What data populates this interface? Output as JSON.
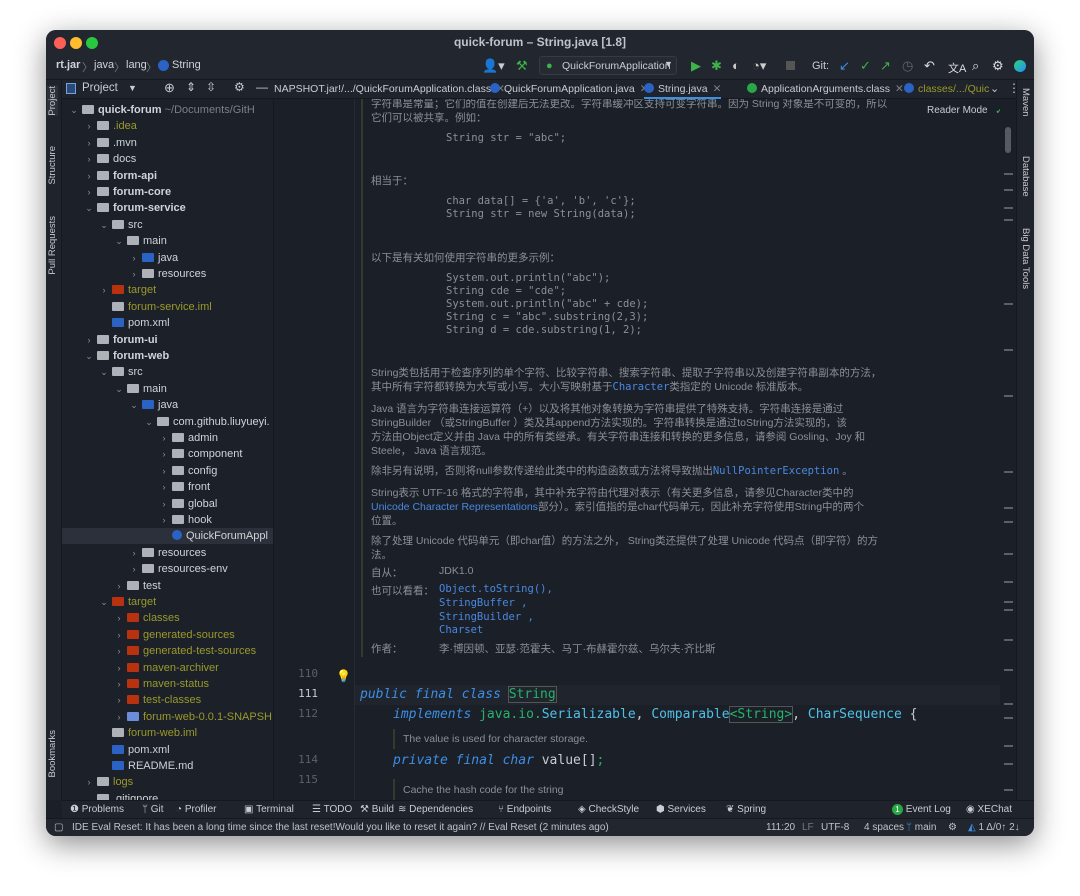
{
  "window": {
    "title": "quick-forum – String.java [1.8]"
  },
  "breadcrumb": [
    "rt.jar",
    "java",
    "lang",
    "String"
  ],
  "toolbar": {
    "run_config": "QuickForumApplication",
    "git_label": "Git:"
  },
  "project_panel": {
    "title": "Project"
  },
  "tabs": [
    {
      "label": "NAPSHOT.jar!/.../QuickForumApplication.class",
      "active": false
    },
    {
      "label": "QuickForumApplication.java",
      "active": false
    },
    {
      "label": "String.java",
      "active": true
    },
    {
      "label": "ApplicationArguments.class",
      "active": false
    },
    {
      "label": "classes/.../Quic",
      "active": false
    }
  ],
  "left_stripe": [
    "Project",
    "Structure",
    "Pull Requests",
    "Bookmarks"
  ],
  "right_stripe": [
    "Maven",
    "Database",
    "Big Data Tools"
  ],
  "tree": [
    {
      "label": "quick-forum",
      "extra": " ~/Documents/GitH",
      "d": 0,
      "exp": "v",
      "icon": "module",
      "color": "#d0d3d8",
      "bold": true
    },
    {
      "label": ".idea",
      "d": 1,
      "exp": ">",
      "icon": "folder",
      "color": "#9a9a2a"
    },
    {
      "label": ".mvn",
      "d": 1,
      "exp": ">",
      "icon": "folder",
      "color": "#d0d3d8"
    },
    {
      "label": "docs",
      "d": 1,
      "exp": ">",
      "icon": "folder",
      "color": "#d0d3d8"
    },
    {
      "label": "form-api",
      "d": 1,
      "exp": ">",
      "icon": "module",
      "color": "#d0d3d8",
      "bold": true
    },
    {
      "label": "forum-core",
      "d": 1,
      "exp": ">",
      "icon": "module",
      "color": "#d0d3d8",
      "bold": true
    },
    {
      "label": "forum-service",
      "d": 1,
      "exp": "v",
      "icon": "module",
      "color": "#d0d3d8",
      "bold": true
    },
    {
      "label": "src",
      "d": 2,
      "exp": "v",
      "icon": "folder",
      "color": "#d0d3d8"
    },
    {
      "label": "main",
      "d": 3,
      "exp": "v",
      "icon": "folder",
      "color": "#d0d3d8"
    },
    {
      "label": "java",
      "d": 4,
      "exp": ">",
      "icon": "src",
      "color": "#d0d3d8"
    },
    {
      "label": "resources",
      "d": 4,
      "exp": ">",
      "icon": "folder",
      "color": "#d0d3d8"
    },
    {
      "label": "target",
      "d": 2,
      "exp": ">",
      "icon": "excluded",
      "color": "#9a9a2a"
    },
    {
      "label": "forum-service.iml",
      "d": 2,
      "exp": "",
      "icon": "file",
      "color": "#9a9a2a"
    },
    {
      "label": "pom.xml",
      "d": 2,
      "exp": "",
      "icon": "maven",
      "color": "#d0d3d8"
    },
    {
      "label": "forum-ui",
      "d": 1,
      "exp": ">",
      "icon": "module",
      "color": "#d0d3d8",
      "bold": true
    },
    {
      "label": "forum-web",
      "d": 1,
      "exp": "v",
      "icon": "module",
      "color": "#d0d3d8",
      "bold": true
    },
    {
      "label": "src",
      "d": 2,
      "exp": "v",
      "icon": "folder",
      "color": "#d0d3d8"
    },
    {
      "label": "main",
      "d": 3,
      "exp": "v",
      "icon": "folder",
      "color": "#d0d3d8"
    },
    {
      "label": "java",
      "d": 4,
      "exp": "v",
      "icon": "src",
      "color": "#d0d3d8"
    },
    {
      "label": "com.github.liuyueyi.",
      "d": 5,
      "exp": "v",
      "icon": "package",
      "color": "#d0d3d8"
    },
    {
      "label": "admin",
      "d": 6,
      "exp": ">",
      "icon": "package",
      "color": "#d0d3d8"
    },
    {
      "label": "component",
      "d": 6,
      "exp": ">",
      "icon": "package",
      "color": "#d0d3d8"
    },
    {
      "label": "config",
      "d": 6,
      "exp": ">",
      "icon": "package",
      "color": "#d0d3d8"
    },
    {
      "label": "front",
      "d": 6,
      "exp": ">",
      "icon": "package",
      "color": "#d0d3d8"
    },
    {
      "label": "global",
      "d": 6,
      "exp": ">",
      "icon": "package",
      "color": "#d0d3d8"
    },
    {
      "label": "hook",
      "d": 6,
      "exp": ">",
      "icon": "package",
      "color": "#d0d3d8"
    },
    {
      "label": "QuickForumAppl",
      "d": 6,
      "exp": "",
      "icon": "class",
      "color": "#d0d3d8",
      "sel": true
    },
    {
      "label": "resources",
      "d": 4,
      "exp": ">",
      "icon": "folder",
      "color": "#d0d3d8"
    },
    {
      "label": "resources-env",
      "d": 4,
      "exp": ">",
      "icon": "folder",
      "color": "#d0d3d8"
    },
    {
      "label": "test",
      "d": 3,
      "exp": ">",
      "icon": "folder",
      "color": "#d0d3d8"
    },
    {
      "label": "target",
      "d": 2,
      "exp": "v",
      "icon": "excluded",
      "color": "#9a9a2a"
    },
    {
      "label": "classes",
      "d": 3,
      "exp": ">",
      "icon": "excluded",
      "color": "#9a9a2a"
    },
    {
      "label": "generated-sources",
      "d": 3,
      "exp": ">",
      "icon": "excluded",
      "color": "#9a9a2a"
    },
    {
      "label": "generated-test-sources",
      "d": 3,
      "exp": ">",
      "icon": "excluded",
      "color": "#9a9a2a"
    },
    {
      "label": "maven-archiver",
      "d": 3,
      "exp": ">",
      "icon": "excluded",
      "color": "#9a9a2a"
    },
    {
      "label": "maven-status",
      "d": 3,
      "exp": ">",
      "icon": "excluded",
      "color": "#9a9a2a"
    },
    {
      "label": "test-classes",
      "d": 3,
      "exp": ">",
      "icon": "excluded",
      "color": "#9a9a2a"
    },
    {
      "label": "forum-web-0.0.1-SNAPSH",
      "d": 3,
      "exp": ">",
      "icon": "jar",
      "color": "#9a9a2a"
    },
    {
      "label": "forum-web.iml",
      "d": 2,
      "exp": "",
      "icon": "file",
      "color": "#9a9a2a"
    },
    {
      "label": "pom.xml",
      "d": 2,
      "exp": "",
      "icon": "maven",
      "color": "#d0d3d8"
    },
    {
      "label": "README.md",
      "d": 2,
      "exp": "",
      "icon": "md",
      "color": "#d0d3d8"
    },
    {
      "label": "logs",
      "d": 1,
      "exp": ">",
      "icon": "folder",
      "color": "#9a9a2a"
    },
    {
      "label": ".gitignore",
      "d": 1,
      "exp": "",
      "icon": "file",
      "color": "#d0d3d8"
    }
  ],
  "editor": {
    "reader_mode": "Reader Mode",
    "doc": {
      "l0": "字符串是常量；它们的值在创建后无法更改。字符串缓冲区支持可变字符串。因为 String 对象是不可变的，所以",
      "l1": "它们可以被共享。例如：",
      "c1": "String str = \"abc\";",
      "l2": "相当于：",
      "c2a": "char data[] = {'a', 'b', 'c'};",
      "c2b": "String str = new String(data);",
      "l3": "以下是有关如何使用字符串的更多示例：",
      "c3": [
        "System.out.println(\"abc\");",
        "String cde = \"cde\";",
        "System.out.println(\"abc\" + cde);",
        "String c = \"abc\".substring(2,3);",
        "String d = cde.substring(1, 2);"
      ],
      "p1a": "String类包括用于检查序列的单个字符、比较字符串、搜索字符串、提取子字符串以及创建字符串副本的方法，",
      "p1b_pre": "其中所有字符都转换为大写或小写。大小写映射基于",
      "p1b_link": "Character",
      "p1b_post": "类指定的 Unicode 标准版本。",
      "p2": [
        "Java 语言为字符串连接运算符（+）以及将其他对象转换为字符串提供了特殊支持。字符串连接是通过",
        "StringBuilder （或StringBuffer ）类及其append方法实现的。字符串转换是通过toString方法实现的，该",
        "方法由Object定义并由 Java 中的所有类继承。有关字符串连接和转换的更多信息，请参阅 Gosling、Joy 和",
        "Steele， Java 语言规范。"
      ],
      "p3_pre": "除非另有说明，否则将null参数传递给此类中的构造函数或方法将导致抛出",
      "p3_link": "NullPointerException",
      "p3_post": " 。",
      "p4a": "String表示 UTF-16 格式的字符串，其中补充字符由代理对表示（有关更多信息，请参见Character类中的",
      "p4b_link": "Unicode Character Representations",
      "p4b_post": "部分）。索引值指的是char代码单元，因此补充字符使用String中的两个",
      "p4c": "位置。",
      "p5a": "除了处理 Unicode 代码单元（即char值）的方法之外， String类还提供了处理 Unicode 代码点（即字符）的方",
      "p5b": "法。",
      "since_label": "自从：",
      "since_value": "JDK1.0",
      "see_label": "也可以看看：",
      "see": [
        "Object.toString()",
        "StringBuffer",
        "StringBuilder",
        "Charset"
      ],
      "author_label": "作者：",
      "author_value": "李·博因顿、亚瑟·范霍夫、马丁·布赫霍尔兹、乌尔夫·齐比斯"
    },
    "lines": [
      "110",
      "111",
      "112",
      "114",
      "115"
    ],
    "code": {
      "kw_public": "public",
      "kw_final": "final",
      "kw_class": "class",
      "name": "String",
      "kw_implements": "implements",
      "pkg": "java.io.",
      "serializable": "Serializable",
      "comparable": "Comparable",
      "generic": "String",
      "charseq": "CharSequence",
      "comment1": "The value is used for character storage.",
      "kw_private": "private",
      "kw_char": "char",
      "field": "value[]",
      "comment2": "Cache the hash code for the string"
    }
  },
  "tool_windows": [
    "Problems",
    "Git",
    "Profiler",
    "Terminal",
    "TODO",
    "Build",
    "Dependencies",
    "Endpoints",
    "CheckStyle",
    "Services",
    "Spring"
  ],
  "tool_windows_right": {
    "event_log": "Event Log",
    "event_count": "1",
    "xechat": "XEChat"
  },
  "status": {
    "message": "IDE Eval Reset: It has been a long time since the last reset!Would you like to reset it again? // Eval Reset (2 minutes ago)",
    "position": "111:20",
    "line_sep": "LF",
    "encoding": "UTF-8",
    "indent": "4 spaces",
    "branch": "main",
    "git_counts": "1 Δ/0↑ 2↓"
  },
  "colors": {
    "accent": "#3d8fe6",
    "class_name": "#27b36a",
    "excluded": "#9a9a2a",
    "background": "#1b1f27"
  }
}
